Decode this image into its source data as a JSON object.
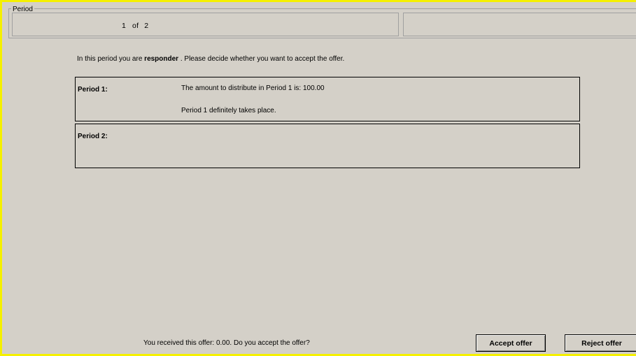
{
  "header": {
    "group_title": "Period",
    "current_period": "1",
    "of_label": "of",
    "total_periods": "2"
  },
  "info": {
    "prefix": "In this period you are",
    "role": "responder",
    "suffix": ". Please decide whether you want to accept the offer."
  },
  "periods": [
    {
      "label": "Period 1:",
      "line1": "The amount to distribute in Period 1 is: 100.00",
      "line2": "Period 1 definitely takes place."
    },
    {
      "label": "Period 2:",
      "line1": "",
      "line2": ""
    }
  ],
  "footer": {
    "question": "You received this offer: 0.00. Do you accept the offer?",
    "accept_label": "Accept offer",
    "reject_label": "Reject offer"
  },
  "colors": {
    "window_border": "#f5f000",
    "background": "#d4d0c8"
  }
}
